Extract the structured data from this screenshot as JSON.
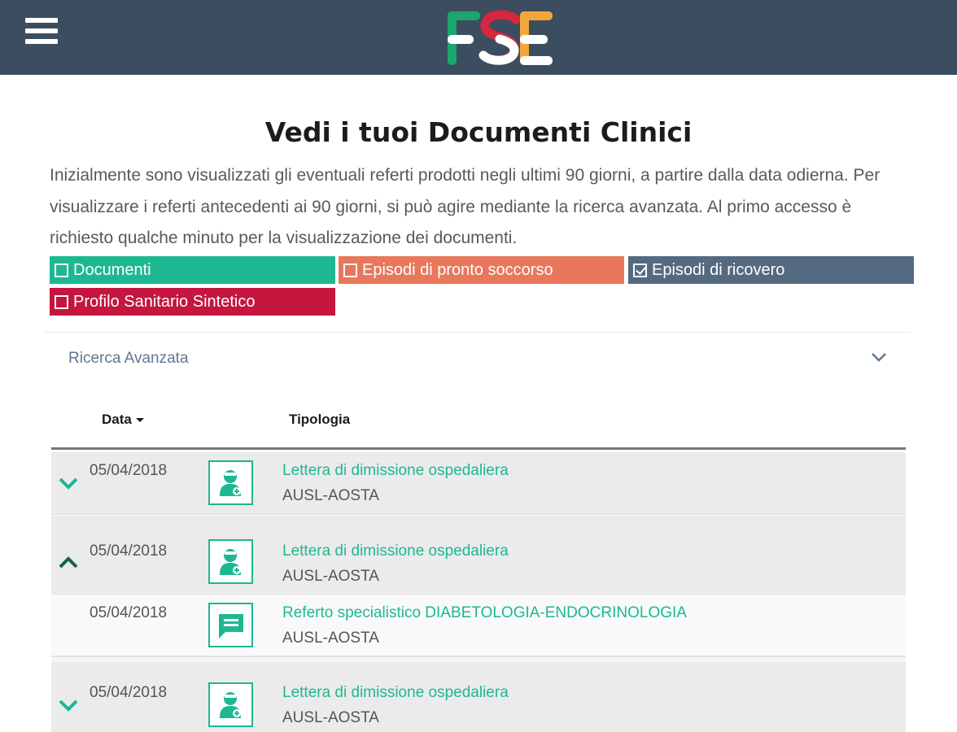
{
  "header": {
    "logo_text": "FSE",
    "logo_colors": [
      "#1aa66e",
      "#d7263d",
      "#f2a73b",
      "#ffffff"
    ],
    "menu_icon": "hamburger-icon",
    "background_color": "#3c4d60"
  },
  "page": {
    "title": "Vedi i tuoi Documenti Clinici",
    "intro": "Inizialmente sono visualizzati gli eventuali referti prodotti negli ultimi 90 giorni, a partire dalla data odierna. Per visualizzare i referti antecedenti ai 90 giorni, si può agire mediante la ricerca avanzata. Al primo accesso è richiesto qualche minuto per la visualizzazione dei documenti."
  },
  "filters": [
    {
      "label": "Documenti",
      "checked": false,
      "color": "#1db892"
    },
    {
      "label": "Episodi di pronto soccorso",
      "checked": false,
      "color": "#e8775c"
    },
    {
      "label": "Episodi di ricovero",
      "checked": true,
      "color": "#546a80"
    },
    {
      "label": "Profilo Sanitario Sintetico",
      "checked": false,
      "color": "#c4163e"
    }
  ],
  "advanced_search": {
    "label": "Ricerca Avanzata",
    "icon": "chevron-down-icon"
  },
  "table": {
    "columns": {
      "date": "Data",
      "type": "Tipologia"
    },
    "sort": {
      "column": "Data",
      "direction": "desc"
    },
    "rows": [
      {
        "date": "05/04/2018",
        "title": "Lettera di dimissione ospedaliera",
        "org": "AUSL-AOSTA",
        "icon": "doctor-document-icon",
        "expander": "chevron-down-icon"
      },
      {
        "date": "05/04/2018",
        "title": "Lettera di dimissione ospedaliera",
        "org": "AUSL-AOSTA",
        "icon": "doctor-document-icon",
        "expander": "chevron-up-icon"
      },
      {
        "date": "05/04/2018",
        "title": "Referto specialistico DIABETOLOGIA-ENDOCRINOLOGIA",
        "org": "AUSL-AOSTA",
        "icon": "report-message-icon",
        "expander": null
      },
      {
        "date": "05/04/2018",
        "title": "Lettera di dimissione ospedaliera",
        "org": "AUSL-AOSTA",
        "icon": "doctor-document-icon",
        "expander": "chevron-down-icon"
      }
    ]
  },
  "colors": {
    "accent_green": "#1db892",
    "chevron_dark": "#14614c"
  }
}
